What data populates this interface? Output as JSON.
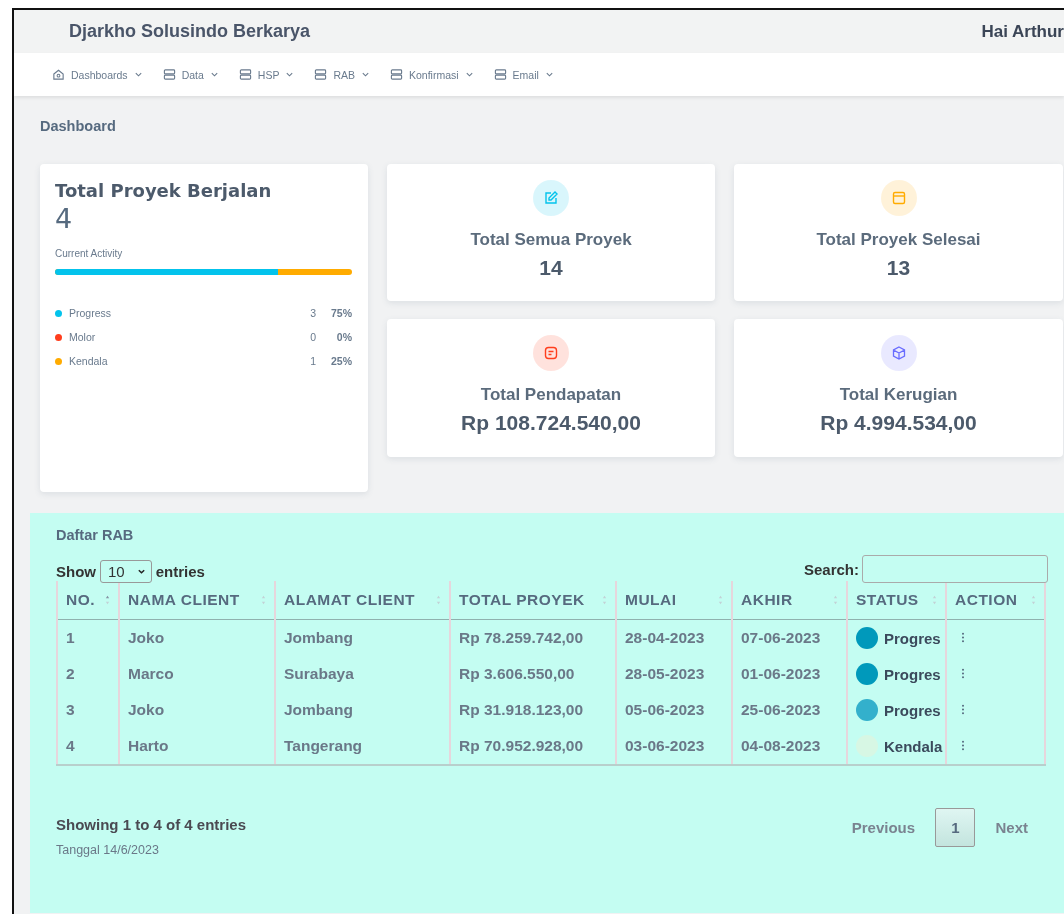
{
  "header": {
    "brand": "Djarkho Solusindo Berkarya",
    "greeting": "Hai Arthur"
  },
  "nav": [
    {
      "label": "Dashboards"
    },
    {
      "label": "Data"
    },
    {
      "label": "HSP"
    },
    {
      "label": "RAB"
    },
    {
      "label": "Konfirmasi"
    },
    {
      "label": "Email"
    }
  ],
  "page_title": "Dashboard",
  "running": {
    "title": "Total Proyek Berjalan",
    "value": "4",
    "activity_label": "Current Activity",
    "activity": {
      "level": 0.75
    },
    "legend": [
      {
        "label": "Progress",
        "count": "3",
        "percent": "75%",
        "color": "#03c3ec"
      },
      {
        "label": "Molor",
        "count": "0",
        "percent": "0%",
        "color": "#ff3e1d"
      },
      {
        "label": "Kendala",
        "count": "1",
        "percent": "25%",
        "color": "#ffab00"
      }
    ]
  },
  "stats": [
    {
      "title": "Total Semua Proyek",
      "value": "14",
      "color": "#03c3ec"
    },
    {
      "title": "Total Proyek Selesai",
      "value": "13",
      "color": "#ffab00"
    },
    {
      "title": "Total Pendapatan",
      "value": "Rp 108.724.540,00",
      "color": "#ff3e1d"
    },
    {
      "title": "Total Kerugian",
      "value": "Rp 4.994.534,00",
      "color": "#696cff"
    }
  ],
  "table": {
    "title": "Daftar RAB",
    "show_label": "Show",
    "page_size": "10",
    "entries_label": "entries",
    "search_label": "Search:",
    "columns": [
      "NO.",
      "NAMA CLIENT",
      "ALAMAT CLIENT",
      "TOTAL PROYEK",
      "MULAI",
      "AKHIR",
      "STATUS",
      "ACTION"
    ],
    "rows": [
      {
        "no": "1",
        "name": "Joko",
        "address": "Jombang",
        "total": "Rp 78.259.742,00",
        "start": "28-04-2023",
        "end": "07-06-2023",
        "status": "Progres",
        "color": "#0099bb"
      },
      {
        "no": "2",
        "name": "Marco",
        "address": "Surabaya",
        "total": "Rp 3.606.550,00",
        "start": "28-05-2023",
        "end": "01-06-2023",
        "status": "Progres",
        "color": "#0099bb"
      },
      {
        "no": "3",
        "name": "Joko",
        "address": "Jombang",
        "total": "Rp 31.918.123,00",
        "start": "05-06-2023",
        "end": "25-06-2023",
        "status": "Progres",
        "color": "#33b0cc"
      },
      {
        "no": "4",
        "name": "Harto",
        "address": "Tangerang",
        "total": "Rp 70.952.928,00",
        "start": "03-06-2023",
        "end": "04-08-2023",
        "status": "Kendala",
        "color": "#d7f7e4"
      }
    ],
    "info": "Showing 1 to 4 of 4 entries",
    "date": "Tanggal 14/6/2023",
    "pagination": {
      "previous": "Previous",
      "pages": [
        {
          "label": "1",
          "selected": true
        }
      ],
      "next": "Next"
    }
  }
}
